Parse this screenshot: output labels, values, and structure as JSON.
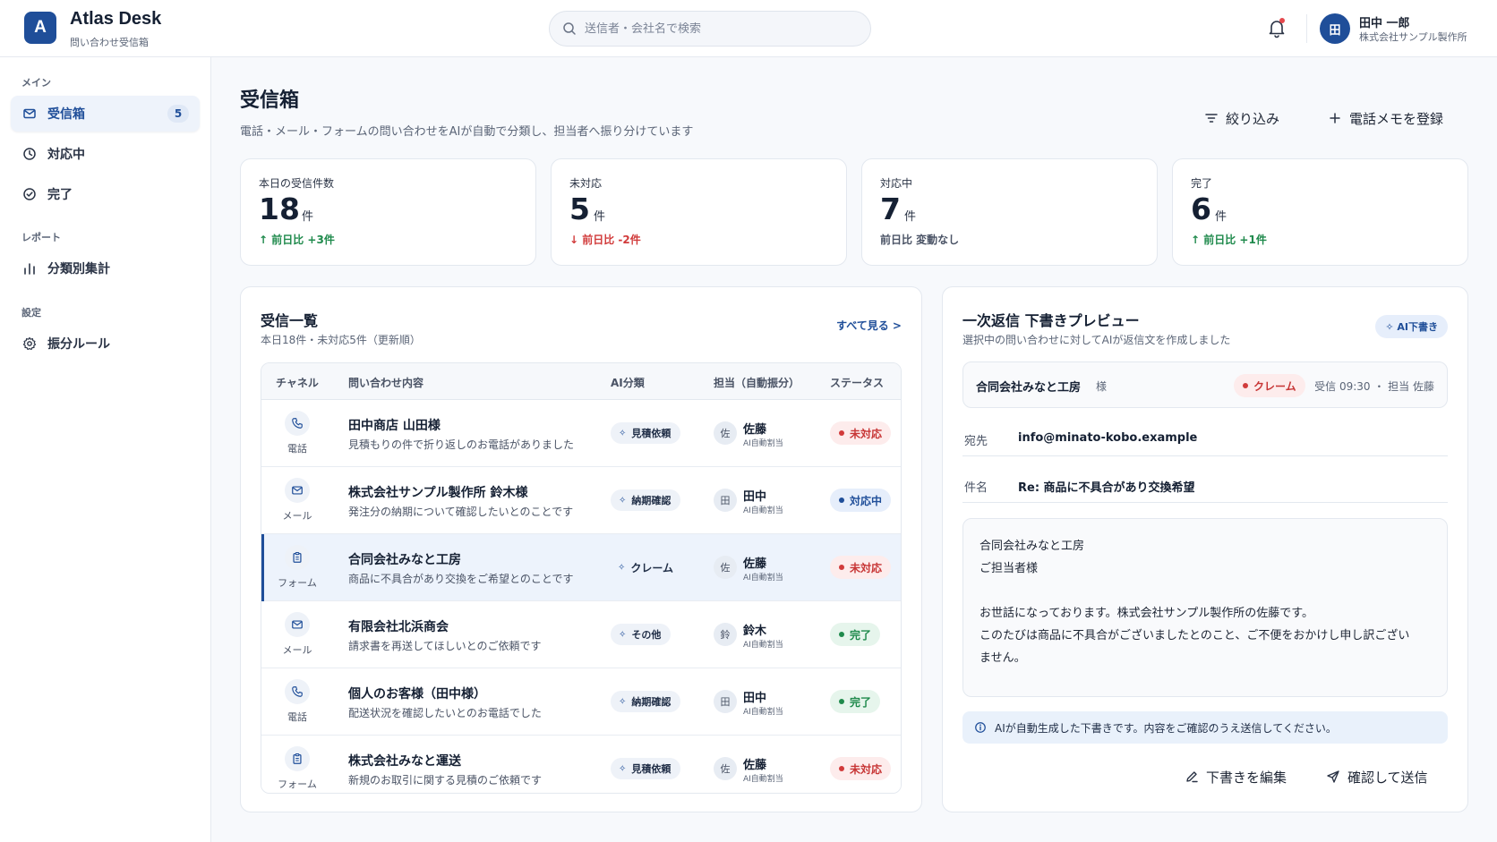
{
  "app": {
    "logo_letter": "A",
    "title": "Atlas Desk",
    "subtitle": "問い合わせ受信箱"
  },
  "search": {
    "placeholder": "送信者・会社名で検索"
  },
  "user": {
    "initial": "田",
    "name": "田中 一郎",
    "company": "株式会社サンプル製作所"
  },
  "sidebar": {
    "sections": [
      {
        "label": "メイン"
      },
      {
        "label": "レポート"
      },
      {
        "label": "設定"
      }
    ],
    "items": [
      {
        "label": "受信箱",
        "badge": "5",
        "icon": "mail-icon",
        "active": true
      },
      {
        "label": "対応中",
        "icon": "clock-icon"
      },
      {
        "label": "完了",
        "icon": "check-circle-icon"
      },
      {
        "label": "分類別集計",
        "icon": "bar-chart-icon"
      },
      {
        "label": "振分ルール",
        "icon": "gear-icon"
      }
    ]
  },
  "page": {
    "title": "受信箱",
    "description": "電話・メール・フォームの問い合わせをAIが自動で分類し、担当者へ振り分けています",
    "filter_label": "絞り込み",
    "add_memo_label": "電話メモを登録"
  },
  "stats": [
    {
      "label": "本日の受信件数",
      "value": "18",
      "unit": "件",
      "delta": "前日比 +3件",
      "trend": "up"
    },
    {
      "label": "未対応",
      "value": "5",
      "unit": "件",
      "delta": "前日比 -2件",
      "trend": "down"
    },
    {
      "label": "対応中",
      "value": "7",
      "unit": "件",
      "delta": "前日比 変動なし",
      "trend": "flat"
    },
    {
      "label": "完了",
      "value": "6",
      "unit": "件",
      "delta": "前日比 +1件",
      "trend": "up"
    }
  ],
  "inbox": {
    "title": "受信一覧",
    "subtitle": "本日18件・未対応5件（更新順）",
    "see_all": "すべて見る >",
    "columns": [
      "チャネル",
      "問い合わせ内容",
      "AI分類",
      "担当（自動振分）",
      "ステータス"
    ],
    "rows": [
      {
        "channel": "電話",
        "channel_icon": "phone-icon",
        "title": "田中商店 山田様",
        "desc": "見積もりの件で折り返しのお電話がありました",
        "category": "見積依頼",
        "assignee_initial": "佐",
        "assignee": "佐藤",
        "assignee_sub": "AI自動割当",
        "status": "未対応",
        "status_kind": "open"
      },
      {
        "channel": "メール",
        "channel_icon": "mail-icon",
        "title": "株式会社サンプル製作所 鈴木様",
        "desc": "発注分の納期について確認したいとのことです",
        "category": "納期確認",
        "assignee_initial": "田",
        "assignee": "田中",
        "assignee_sub": "AI自動割当",
        "status": "対応中",
        "status_kind": "progress"
      },
      {
        "channel": "フォーム",
        "channel_icon": "clipboard-icon",
        "title": "合同会社みなと工房",
        "desc": "商品に不具合があり交換をご希望とのことです",
        "category": "クレーム",
        "assignee_initial": "佐",
        "assignee": "佐藤",
        "assignee_sub": "AI自動割当",
        "status": "未対応",
        "status_kind": "open",
        "selected": true
      },
      {
        "channel": "メール",
        "channel_icon": "mail-icon",
        "title": "有限会社北浜商会",
        "desc": "請求書を再送してほしいとのご依頼です",
        "category": "その他",
        "assignee_initial": "鈴",
        "assignee": "鈴木",
        "assignee_sub": "AI自動割当",
        "status": "完了",
        "status_kind": "done"
      },
      {
        "channel": "電話",
        "channel_icon": "phone-icon",
        "title": "個人のお客様（田中様）",
        "desc": "配送状況を確認したいとのお電話でした",
        "category": "納期確認",
        "assignee_initial": "田",
        "assignee": "田中",
        "assignee_sub": "AI自動割当",
        "status": "完了",
        "status_kind": "done"
      },
      {
        "channel": "フォーム",
        "channel_icon": "clipboard-icon",
        "title": "株式会社みなと運送",
        "desc": "新規のお取引に関する見積のご依頼です",
        "category": "見積依頼",
        "assignee_initial": "佐",
        "assignee": "佐藤",
        "assignee_sub": "AI自動割当",
        "status": "未対応",
        "status_kind": "open"
      }
    ]
  },
  "preview": {
    "title": "一次返信 下書きプレビュー",
    "subtitle": "選択中の問い合わせに対してAIが返信文を作成しました",
    "badge": "✧ AI下書き",
    "company": "合同会社みなと工房",
    "honorific": "様",
    "category": "クレーム",
    "meta": "受信 09:30 ・ 担当 佐藤",
    "to_label": "宛先",
    "to_value": "info@minato-kobo.example",
    "subject_label": "件名",
    "subject_value": "Re: 商品に不具合があり交換希望",
    "body_lines": [
      "合同会社みなと工房",
      "ご担当者様",
      "",
      "お世話になっております。株式会社サンプル製作所の佐藤です。",
      "このたびは商品に不具合がございましたとのこと、ご不便をおかけし申し訳ござい",
      "ません。"
    ],
    "note": "AIが自動生成した下書きです。内容をご確認のうえ送信してください。",
    "edit_label": "下書きを編集",
    "send_label": "確認して送信"
  },
  "colors": {
    "brand": "#1f4e99",
    "danger": "#d13b3b",
    "success": "#1f8a4c"
  }
}
